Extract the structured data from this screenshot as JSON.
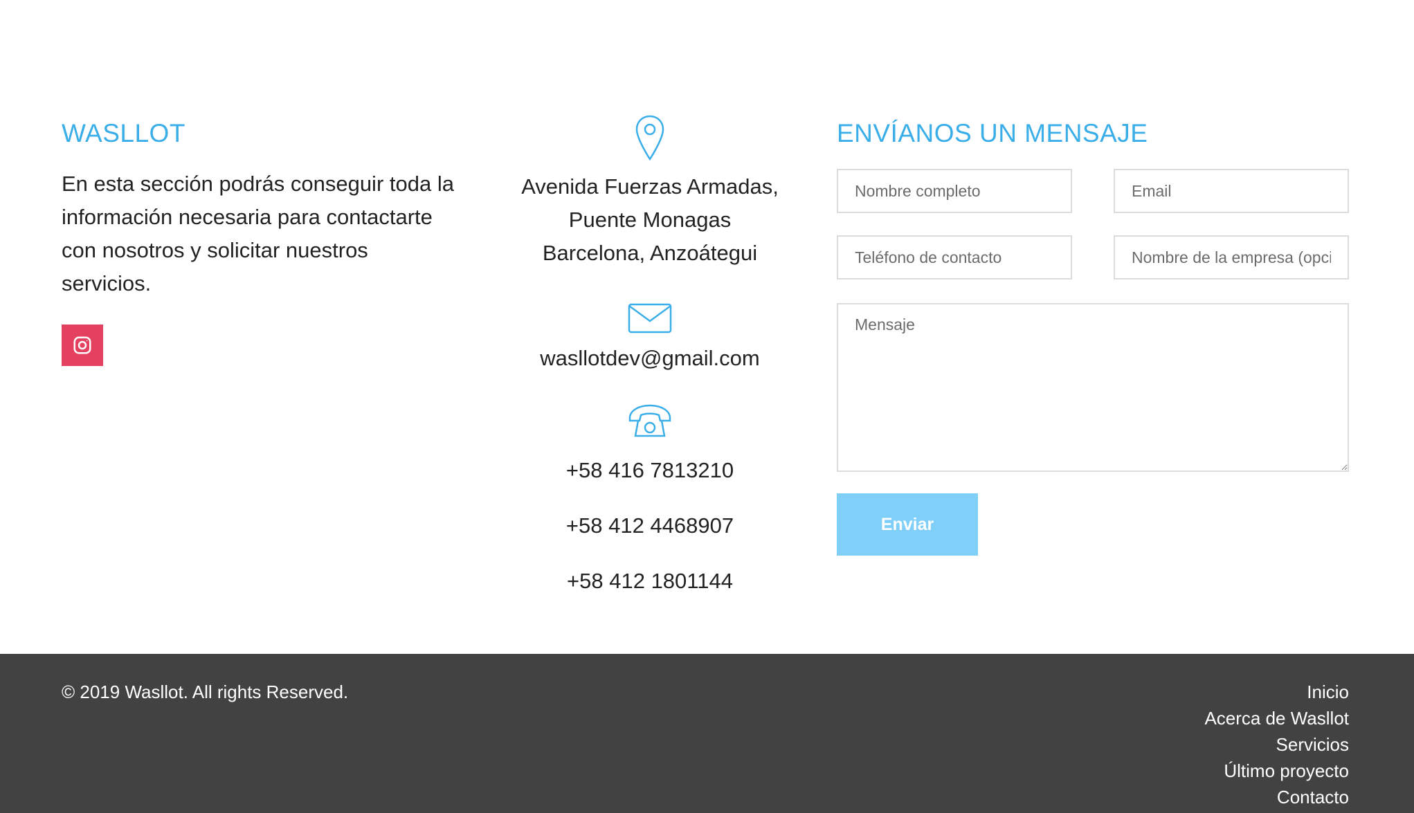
{
  "about": {
    "title": "WASLLOT",
    "description": "En esta sección podrás conseguir toda la información necesaria para contactarte con nosotros y solicitar nuestros servicios.",
    "social_icon": "instagram-icon",
    "social_color": "#e4405f"
  },
  "contact_info": {
    "location_icon": "map-pin-icon",
    "address_lines": [
      "Avenida Fuerzas Armadas,",
      "Puente Monagas",
      "Barcelona, Anzoátegui"
    ],
    "email_icon": "envelope-icon",
    "email": "wasllotdev@gmail.com",
    "phone_icon": "telephone-icon",
    "phones": [
      "+58 416 7813210",
      "+58 412 4468907",
      "+58 412 1801144"
    ]
  },
  "form": {
    "title": "ENVÍANOS UN MENSAJE",
    "name_placeholder": "Nombre completo",
    "email_placeholder": "Email",
    "phone_placeholder": "Teléfono de contacto",
    "company_placeholder": "Nombre de la empresa (opcional)",
    "message_placeholder": "Mensaje",
    "submit_label": "Enviar"
  },
  "footer": {
    "copyright": "© 2019 Wasllot. All rights Reserved.",
    "nav": [
      "Inicio",
      "Acerca de Wasllot",
      "Servicios",
      "Último proyecto",
      "Contacto"
    ]
  },
  "colors": {
    "accent": "#3aaee8",
    "button": "#7fcff9",
    "footer_bg": "#424242",
    "instagram": "#e4405f"
  }
}
